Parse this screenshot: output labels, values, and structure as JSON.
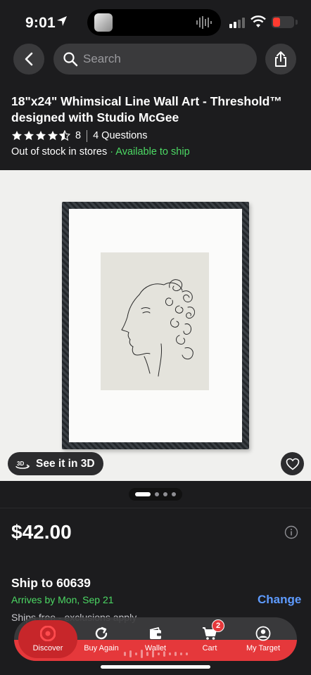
{
  "status_bar": {
    "time": "9:01"
  },
  "search": {
    "placeholder": "Search"
  },
  "product": {
    "title": "18\"x24\" Whimsical Line Wall Art - Threshold™ designed with Studio McGee",
    "rating": 4.5,
    "rating_count": "8",
    "questions": "4 Questions",
    "stock_status": "Out of stock in stores",
    "separator": " · ",
    "ship_availability": "Available to ship",
    "see_in_3d": "See it in 3D",
    "price": "$42.00"
  },
  "carousel": {
    "total": 4,
    "active_index": 0
  },
  "shipping": {
    "title": "Ship to 60639",
    "arrives": "Arrives by Mon, Sep 21",
    "change": "Change",
    "note": "Ships free - exclusions apply"
  },
  "tabs": [
    {
      "label": "Discover",
      "icon": "target-logo-icon",
      "active": true
    },
    {
      "label": "Buy Again",
      "icon": "refresh-icon"
    },
    {
      "label": "Wallet",
      "icon": "wallet-icon"
    },
    {
      "label": "Cart",
      "icon": "cart-icon",
      "badge": "2"
    },
    {
      "label": "My Target",
      "icon": "profile-icon"
    }
  ],
  "colors": {
    "background": "#1c1c1e",
    "accent_red": "#e5383b",
    "available_green": "#4cd964",
    "link_blue": "#5e9bff"
  }
}
